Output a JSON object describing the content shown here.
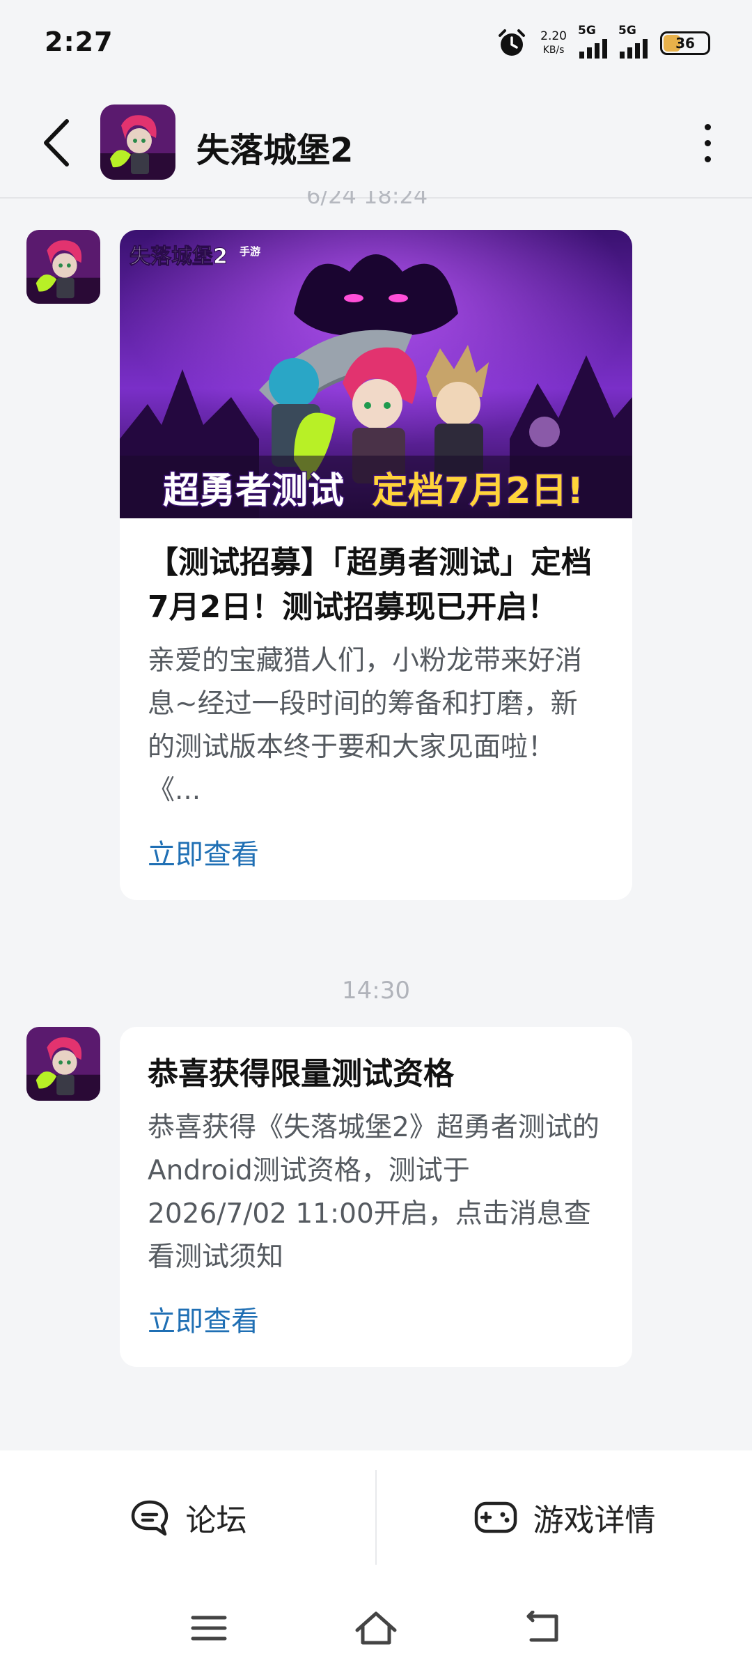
{
  "status_bar": {
    "time": "2:27",
    "net_speed_value": "2.20",
    "net_speed_unit": "KB/s",
    "signal1_label": "5G",
    "signal2_label": "5G",
    "battery_level": "36",
    "icons": [
      "alarm-icon",
      "signal-icon",
      "signal-icon",
      "battery-icon"
    ]
  },
  "header": {
    "title": "失落城堡2",
    "icons": [
      "back-icon",
      "app-icon",
      "more-icon"
    ]
  },
  "partial_timestamp": "6/24 18:24",
  "messages": [
    {
      "banner": {
        "logo_text": "失落城堡2",
        "logo_sub": "手游",
        "caption_left": "超勇者测试",
        "caption_right": "定档7月2日!"
      },
      "title": "【测试招募】「超勇者测试」定档7月2日！测试招募现已开启！",
      "description": "亲爱的宝藏猎人们，小粉龙带来好消息~经过一段时间的筹备和打磨，新的测试版本终于要和大家见面啦！《...",
      "link": "立即查看"
    },
    {
      "timestamp": "14:30",
      "title": "恭喜获得限量测试资格",
      "description": "恭喜获得《失落城堡2》超勇者测试的Android测试资格，测试于2026/7/02 11:00开启，点击消息查看测试须知",
      "link": "立即查看"
    }
  ],
  "bottom_bar": {
    "forum_label": "论坛",
    "game_detail_label": "游戏详情"
  },
  "colors": {
    "background": "#f4f5f7",
    "link": "#1f6fb4",
    "banner_purple": "#6a2bb8"
  }
}
